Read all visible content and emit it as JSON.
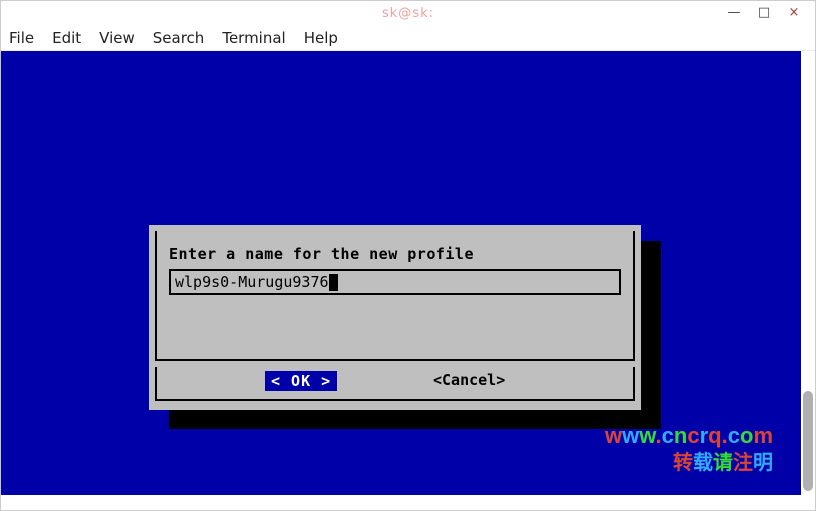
{
  "window": {
    "title": "sk@sk:",
    "controls": {
      "minimize": "—",
      "maximize": "□",
      "close": "×"
    }
  },
  "menubar": {
    "file": "File",
    "edit": "Edit",
    "view": "View",
    "search": "Search",
    "terminal": "Terminal",
    "help": "Help"
  },
  "dialog": {
    "prompt": "Enter a name for the new profile",
    "input_value": "wlp9s0-Murugu9376",
    "ok_label": "<  OK  >",
    "cancel_label": "<Cancel>"
  },
  "watermark": {
    "url": "www.cncrq.com",
    "text": "转载请注明"
  }
}
